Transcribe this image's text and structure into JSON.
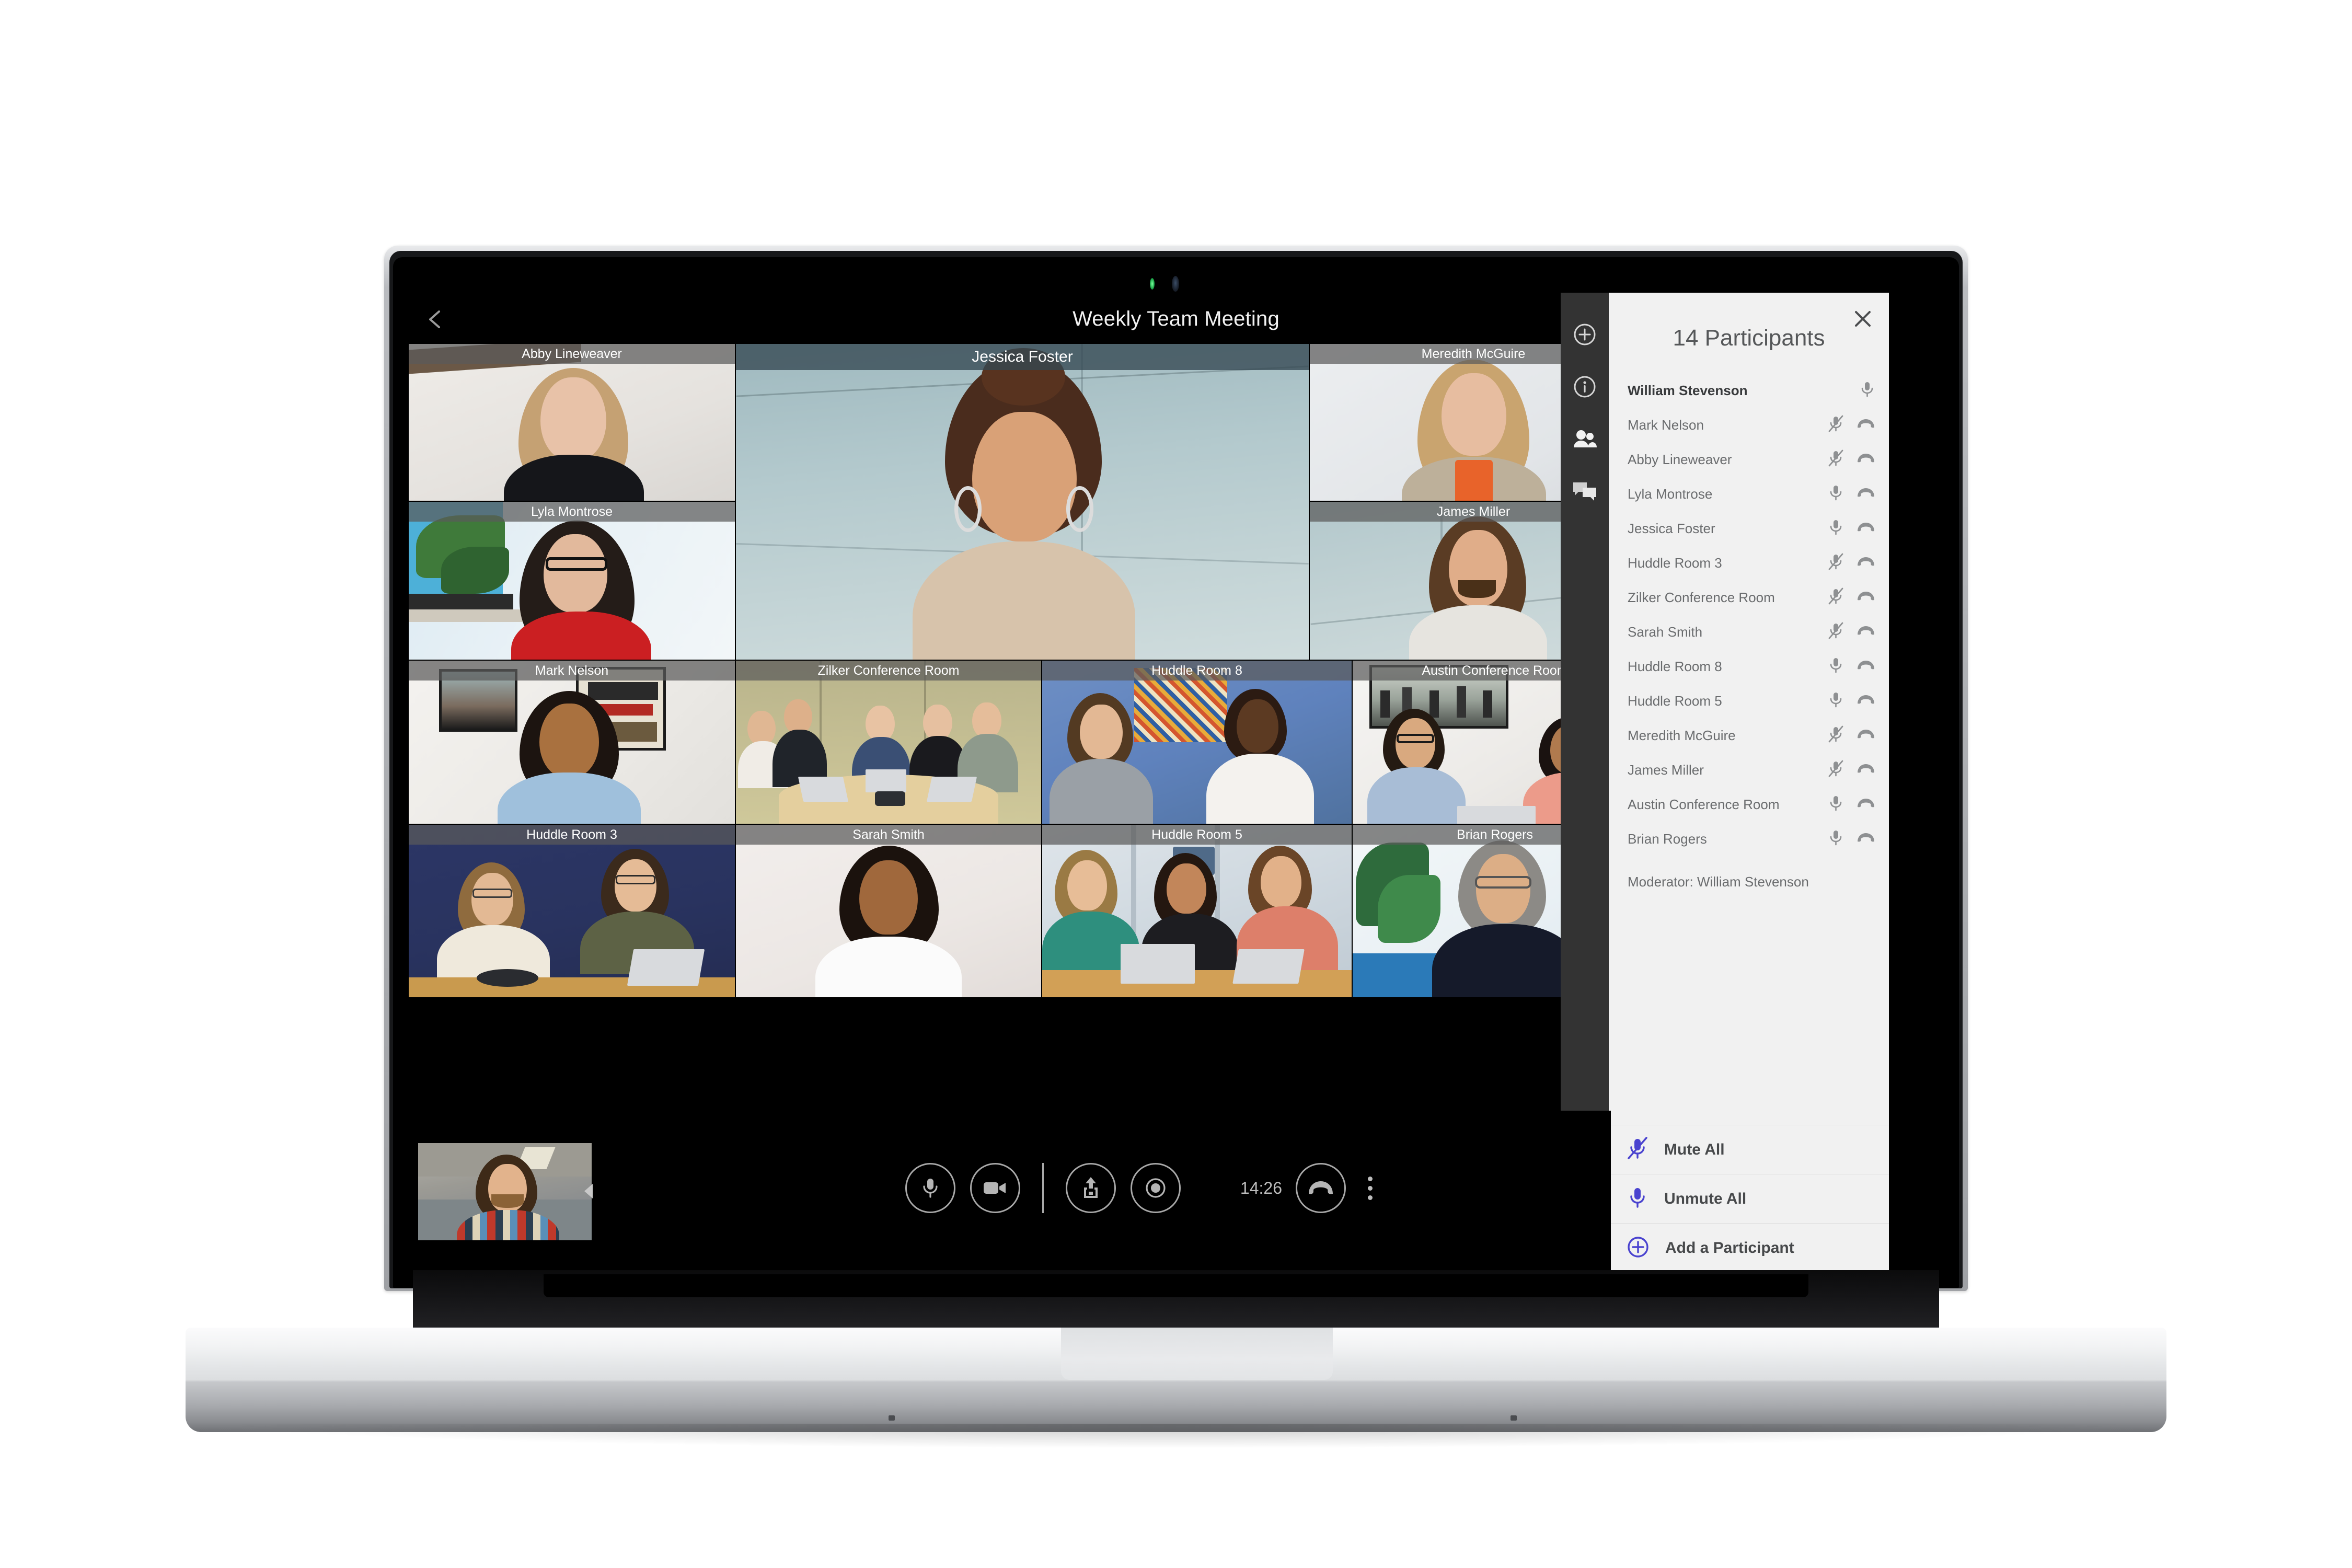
{
  "app": {
    "meeting_title": "Weekly Team Meeting",
    "back_icon": "chevron-left-icon"
  },
  "icon_rail": [
    {
      "name": "add-participant-icon",
      "label": "Add Participant"
    },
    {
      "name": "info-icon",
      "label": "Meeting Info"
    },
    {
      "name": "participants-icon",
      "label": "Participants"
    },
    {
      "name": "chat-icon",
      "label": "Chat"
    }
  ],
  "panel": {
    "close_icon": "close-icon",
    "title": "14 Participants",
    "moderator": "Moderator: William Stevenson",
    "participants": [
      {
        "name": "William Stevenson",
        "is_me": true,
        "mic": "mic-on",
        "hangup": false
      },
      {
        "name": "Mark Nelson",
        "is_me": false,
        "mic": "mic-off",
        "hangup": true
      },
      {
        "name": "Abby Lineweaver",
        "is_me": false,
        "mic": "mic-off",
        "hangup": true
      },
      {
        "name": "Lyla Montrose",
        "is_me": false,
        "mic": "mic-on",
        "hangup": true
      },
      {
        "name": "Jessica Foster",
        "is_me": false,
        "mic": "mic-on",
        "hangup": true
      },
      {
        "name": "Huddle Room 3",
        "is_me": false,
        "mic": "mic-off",
        "hangup": true
      },
      {
        "name": "Zilker Conference Room",
        "is_me": false,
        "mic": "mic-off",
        "hangup": true
      },
      {
        "name": "Sarah Smith",
        "is_me": false,
        "mic": "mic-off",
        "hangup": true
      },
      {
        "name": "Huddle Room 8",
        "is_me": false,
        "mic": "mic-on",
        "hangup": true
      },
      {
        "name": "Huddle Room 5",
        "is_me": false,
        "mic": "mic-on",
        "hangup": true
      },
      {
        "name": "Meredith McGuire",
        "is_me": false,
        "mic": "mic-off",
        "hangup": true
      },
      {
        "name": "James Miller",
        "is_me": false,
        "mic": "mic-off",
        "hangup": true
      },
      {
        "name": "Austin Conference Room",
        "is_me": false,
        "mic": "mic-on",
        "hangup": true
      },
      {
        "name": "Brian Rogers",
        "is_me": false,
        "mic": "mic-on",
        "hangup": true
      }
    ],
    "actions": [
      {
        "icon": "mic-off-icon",
        "label": "Mute All"
      },
      {
        "icon": "mic-on-icon",
        "label": "Unmute All"
      },
      {
        "icon": "add-circle-icon",
        "label": "Add a Participant"
      }
    ],
    "accent_color": "#4a43cf"
  },
  "grid": {
    "tiles": [
      {
        "name": "Abby Lineweaver",
        "active": false
      },
      {
        "name": "Lyla Montrose",
        "active": false
      },
      {
        "name": "Jessica Foster",
        "active": true
      },
      {
        "name": "Meredith McGuire",
        "active": false
      },
      {
        "name": "James Miller",
        "active": false
      },
      {
        "name": "Mark Nelson",
        "active": false
      },
      {
        "name": "Zilker Conference Room",
        "active": false
      },
      {
        "name": "Huddle Room 8",
        "active": false
      },
      {
        "name": "Austin Conference Room",
        "active": false
      },
      {
        "name": "Huddle Room 3",
        "active": false
      },
      {
        "name": "Sarah Smith",
        "active": false
      },
      {
        "name": "Huddle Room 5",
        "active": false
      },
      {
        "name": "Brian Rogers",
        "active": false
      }
    ]
  },
  "controls": {
    "mic_icon": "mic-icon",
    "camera_icon": "camera-icon",
    "share_icon": "share-screen-icon",
    "record_icon": "record-icon",
    "call_timer": "14:26",
    "hangup_icon": "hangup-icon",
    "more_icon": "kebab-menu-icon",
    "self_view_label": "self-view"
  }
}
